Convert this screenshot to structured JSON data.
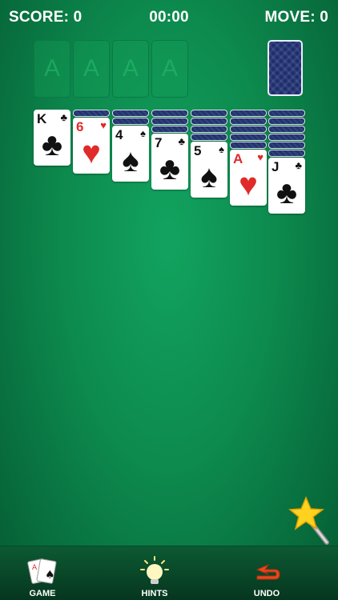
{
  "header": {
    "score": "SCORE: 0",
    "timer": "00:00",
    "moves": "MOVE: 0"
  },
  "foundation_label": "A",
  "tableau": [
    {
      "down": 0,
      "rank": "K",
      "suit": "♣",
      "color": "black"
    },
    {
      "down": 1,
      "rank": "6",
      "suit": "♥",
      "color": "red"
    },
    {
      "down": 2,
      "rank": "4",
      "suit": "♠",
      "color": "black"
    },
    {
      "down": 3,
      "rank": "7",
      "suit": "♣",
      "color": "black"
    },
    {
      "down": 4,
      "rank": "5",
      "suit": "♠",
      "color": "black"
    },
    {
      "down": 5,
      "rank": "A",
      "suit": "♥",
      "color": "red"
    },
    {
      "down": 6,
      "rank": "J",
      "suit": "♣",
      "color": "black"
    }
  ],
  "toolbar": {
    "game_label": "GAME",
    "hints_label": "HINTS",
    "undo_label": "UNDO"
  },
  "colors": {
    "felt": "#0d8a4e",
    "card_back": "#1d2e6e",
    "red_suit": "#e12a2a"
  },
  "icons": {
    "game": "cards-icon",
    "hints": "lightbulb-icon",
    "undo": "undo-arrow-icon",
    "magic": "magic-wand-icon"
  }
}
